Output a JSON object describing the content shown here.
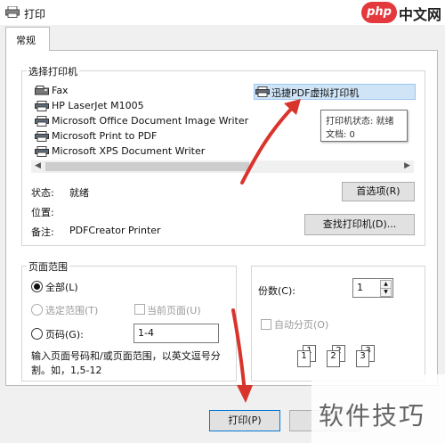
{
  "window": {
    "title": "打印",
    "brand": {
      "php": "php",
      "site": "中文网"
    }
  },
  "tabs": [
    {
      "label": "常规"
    }
  ],
  "select_printer": {
    "group_label": "选择打印机",
    "printers": [
      {
        "label": "Fax",
        "icon": "fax-icon"
      },
      {
        "label": "HP LaserJet M1005",
        "icon": "printer-icon"
      },
      {
        "label": "Microsoft Office Document Image Writer",
        "icon": "printer-icon"
      },
      {
        "label": "Microsoft Print to PDF",
        "icon": "printer-icon"
      },
      {
        "label": "Microsoft XPS Document Writer",
        "icon": "printer-icon"
      }
    ],
    "selected_printer": "迅捷PDF虚拟打印机",
    "tooltip": {
      "status": "打印机状态: 就绪",
      "docs": "文档: 0"
    },
    "status_label": "状态:",
    "status_value": "就绪",
    "location_label": "位置:",
    "comment_label": "备注:",
    "comment_value": "PDFCreator Printer",
    "preferences_button": "首选项(R)",
    "find_printer_button": "查找打印机(D)..."
  },
  "page_range": {
    "group_label": "页面范围",
    "all": "全部(L)",
    "selection": "选定范围(T)",
    "current_page": "当前页面(U)",
    "pages": "页码(G):",
    "pages_value": "1-4",
    "hint": "输入页面号码和/或页面范围，以英文逗号分割。如，1,5-12"
  },
  "copies": {
    "label": "份数(C):",
    "value": "1",
    "collate": "自动分页(O)",
    "collate_pages": [
      "1",
      "1",
      "2",
      "2",
      "3",
      "3"
    ]
  },
  "buttons": {
    "print": "打印(P)"
  },
  "watermark": "软件技巧",
  "colors": {
    "accent": "#0078d7",
    "selection": "#cfe4f7",
    "annotation_arrow": "#d9342b"
  }
}
